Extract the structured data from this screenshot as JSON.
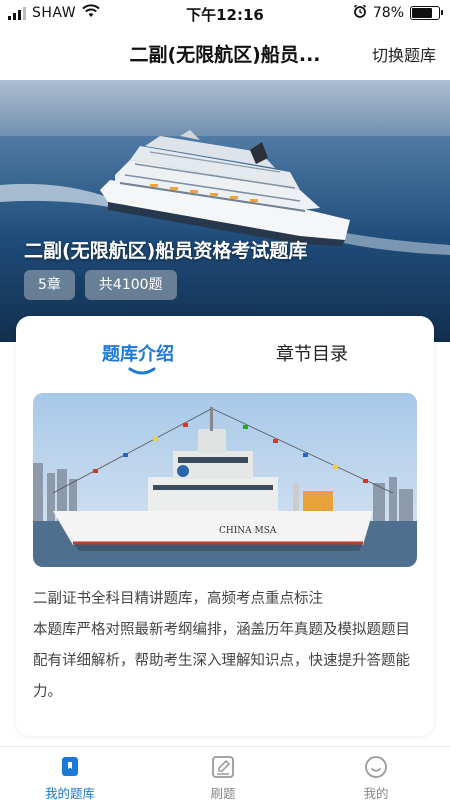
{
  "status_bar": {
    "carrier": "SHAW",
    "time": "下午12:16",
    "battery": "78%",
    "battery_level": 0.78
  },
  "nav": {
    "title": "二副(无限航区)船员...",
    "switch_label": "切换题库"
  },
  "hero": {
    "title": "二副(无限航区)船员资格考试题库",
    "chapters": "5章",
    "questions": "共4100题"
  },
  "tabs": [
    {
      "label": "题库介绍",
      "active": true
    },
    {
      "label": "章节目录",
      "active": false
    }
  ],
  "ship_text": "CHINA MSA",
  "description": [
    "二副证书全科目精讲题库，高频考点重点标注",
    "本题库严格对照最新考纲编排，涵盖历年真题及模拟题题目配有详细解析，帮助考生深入理解知识点，快速提升答题能力。"
  ],
  "tabbar": [
    {
      "label": "我的题库",
      "icon": "book-icon",
      "active": true
    },
    {
      "label": "刷题",
      "icon": "edit-icon",
      "active": false
    },
    {
      "label": "我的",
      "icon": "smile-icon",
      "active": false
    }
  ],
  "colors": {
    "accent": "#1c7ad6",
    "inactive": "#888888"
  }
}
